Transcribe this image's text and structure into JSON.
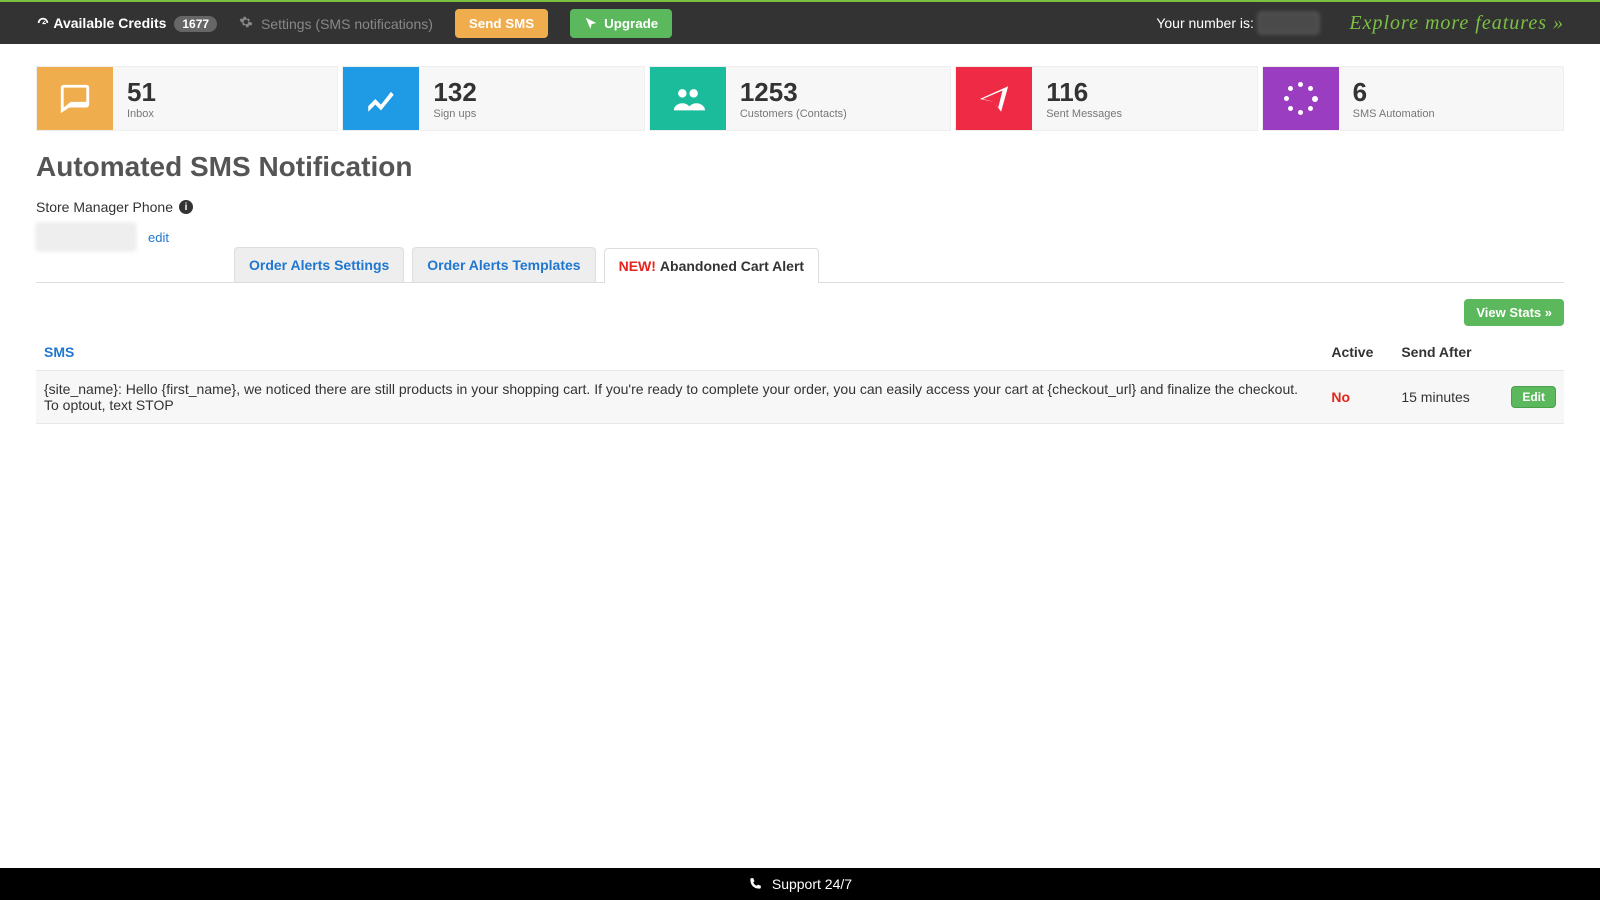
{
  "topbar": {
    "credits_label": "Available Credits",
    "credits_value": "1677",
    "settings_label": "Settings (SMS notifications)",
    "send_sms_label": "Send SMS",
    "upgrade_label": "Upgrade",
    "your_number_label": "Your number is:",
    "your_number_value": "********",
    "explore_label": "Explore more features »"
  },
  "stats": [
    {
      "value": "51",
      "label": "Inbox",
      "color": "bg-orange",
      "icon": "chat-icon"
    },
    {
      "value": "132",
      "label": "Sign ups",
      "color": "bg-blue",
      "icon": "trend-icon"
    },
    {
      "value": "1253",
      "label": "Customers (Contacts)",
      "color": "bg-teal",
      "icon": "users-icon"
    },
    {
      "value": "116",
      "label": "Sent Messages",
      "color": "bg-red",
      "icon": "send-icon"
    },
    {
      "value": "6",
      "label": "SMS Automation",
      "color": "bg-purple",
      "icon": "spinner-icon"
    }
  ],
  "page_title": "Automated SMS Notification",
  "store_phone": {
    "label": "Store Manager Phone",
    "value": "**********",
    "edit_label": "edit"
  },
  "tabs": {
    "t1": "Order Alerts Settings",
    "t2": "Order Alerts Templates",
    "t3_new": "NEW!",
    "t3": "Abandoned Cart Alert"
  },
  "view_stats_label": "View Stats »",
  "table": {
    "headers": {
      "sms": "SMS",
      "active": "Active",
      "send_after": "Send After"
    },
    "rows": [
      {
        "sms": "{site_name}: Hello {first_name}, we noticed there are still products in your shopping cart. If you're ready to complete your order, you can easily access your cart at {checkout_url} and finalize the checkout. To optout, text STOP",
        "active": "No",
        "send_after": "15 minutes",
        "edit_label": "Edit"
      }
    ]
  },
  "footer": {
    "support_label": "Support 24/7"
  }
}
